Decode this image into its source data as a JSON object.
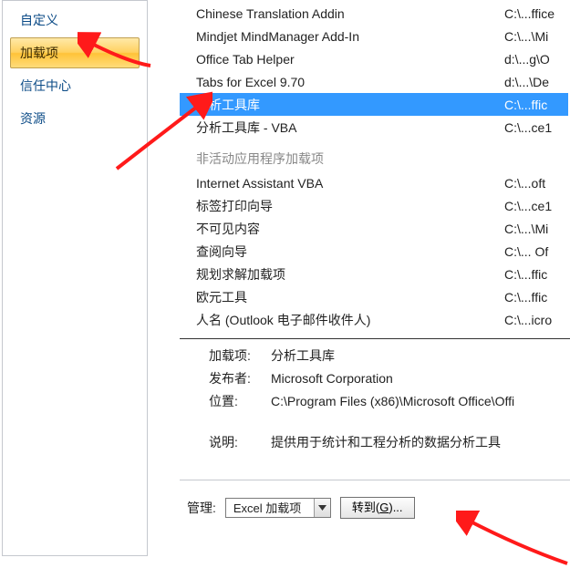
{
  "nav": {
    "items": [
      {
        "label": "自定义",
        "selected": false
      },
      {
        "label": "加载项",
        "selected": true
      },
      {
        "label": "信任中心",
        "selected": false
      },
      {
        "label": "资源",
        "selected": false
      }
    ]
  },
  "addins": {
    "active_rows": [
      {
        "name": "Chinese Translation Addin",
        "path": "C:\\...ffice"
      },
      {
        "name": "Mindjet MindManager Add-In",
        "path": "C:\\...\\Mi"
      },
      {
        "name": "Office Tab Helper",
        "path": "d:\\...g\\O"
      },
      {
        "name": "Tabs for Excel 9.70",
        "path": "d:\\...\\De"
      },
      {
        "name": "分析工具库",
        "path": "C:\\...ffic",
        "selected": true
      },
      {
        "name": "分析工具库 - VBA",
        "path": "C:\\...ce1"
      }
    ],
    "inactive_header": "非活动应用程序加载项",
    "inactive_rows": [
      {
        "name": "Internet Assistant VBA",
        "path": "C:\\...oft "
      },
      {
        "name": "标签打印向导",
        "path": "C:\\...ce1"
      },
      {
        "name": "不可见内容",
        "path": "C:\\...\\Mi"
      },
      {
        "name": "查阅向导",
        "path": "C:\\... Of"
      },
      {
        "name": "规划求解加载项",
        "path": "C:\\...ffic"
      },
      {
        "name": "欧元工具",
        "path": "C:\\...ffic"
      },
      {
        "name": "人名 (Outlook 电子邮件收件人)",
        "path": "C:\\...icro"
      }
    ]
  },
  "details": {
    "labels": {
      "addin": "加载项:",
      "publisher": "发布者:",
      "location": "位置:",
      "description": "说明:"
    },
    "addin": "分析工具库",
    "publisher": "Microsoft Corporation",
    "location": "C:\\Program Files (x86)\\Microsoft Office\\Offi",
    "description": "提供用于统计和工程分析的数据分析工具"
  },
  "manage": {
    "label": "管理:",
    "selected": "Excel 加载项",
    "go_label": "转到(G)..."
  }
}
